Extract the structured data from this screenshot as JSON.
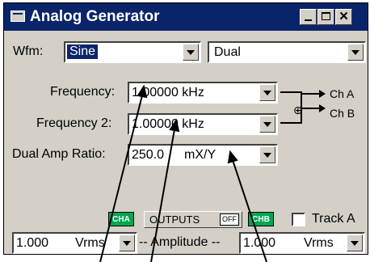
{
  "window": {
    "title": "Analog Generator",
    "close_glyph": "✕"
  },
  "waveform": {
    "label": "Wfm:",
    "value": "Sine",
    "mode": "Dual"
  },
  "frequency": {
    "label": "Frequency:",
    "value": "1.00000 kHz"
  },
  "frequency2": {
    "label": "Frequency 2:",
    "value": "1.00000 kHz"
  },
  "dual_amp_ratio": {
    "label": "Dual Amp Ratio:",
    "value": "250.0",
    "unit": "mX/Y"
  },
  "routing": {
    "ch_a": "Ch A",
    "ch_b": "Ch B",
    "sum_symbol": "⊕"
  },
  "outputs": {
    "cha_badge": "CHA",
    "label": "OUTPUTS",
    "off_badge": "OFF",
    "chb_badge": "CHB",
    "track_label": "Track A",
    "track_checked": false
  },
  "amplitude": {
    "left_value": "1.000",
    "left_unit": "Vrms",
    "label": "-- Amplitude --",
    "right_value": "1.000",
    "right_unit": "Vrms"
  }
}
